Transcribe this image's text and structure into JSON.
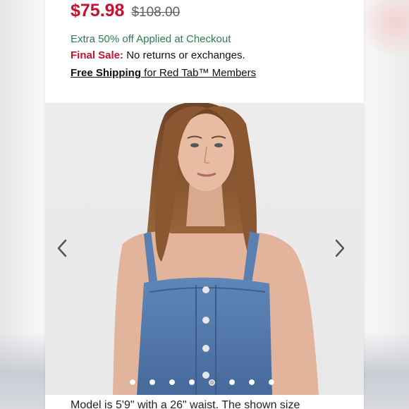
{
  "product": {
    "sale_price": "$75.98",
    "original_price": "$108.00",
    "promo_text": "Extra 50% off Applied at Checkout",
    "final_sale_label": "Final Sale:",
    "final_sale_text": " No returns or exchanges.",
    "shipping_strong": "Free Shipping",
    "shipping_text": " for Red Tab™ Members"
  },
  "gallery": {
    "image_icon": "model-wearing-denim-jumpsuit",
    "prev_icon": "chevron-left-icon",
    "next_icon": "chevron-right-icon",
    "dot_count": 8,
    "active_dot": 4
  },
  "caption": "Model is 5'9\" with a 26\" waist. The shown size",
  "colors": {
    "sale": "#c41230",
    "promo": "#2e7d4f",
    "text": "#111111"
  }
}
